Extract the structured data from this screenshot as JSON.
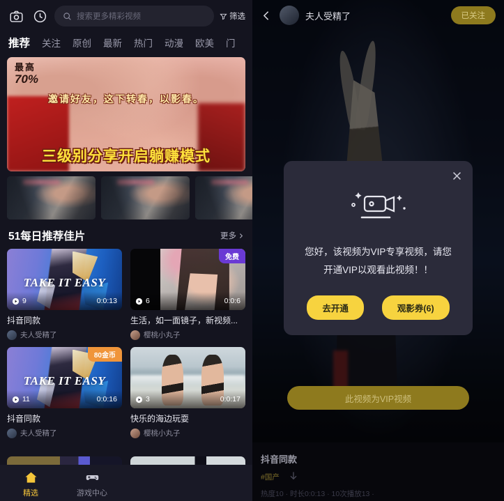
{
  "left": {
    "topbar": {
      "camera_icon": "camera-icon",
      "history_icon": "clock-icon",
      "search_placeholder": "搜索更多精彩视频",
      "search_value": "",
      "filter_label": "筛选",
      "filter_icon": "funnel-icon"
    },
    "tabs": [
      {
        "label": "推荐",
        "active": true
      },
      {
        "label": "关注",
        "active": false
      },
      {
        "label": "原创",
        "active": false
      },
      {
        "label": "最新",
        "active": false
      },
      {
        "label": "热门",
        "active": false
      },
      {
        "label": "动漫",
        "active": false
      },
      {
        "label": "欧美",
        "active": false
      },
      {
        "label": "门",
        "active": false
      }
    ],
    "banner": {
      "top_line1": "最高",
      "top_line2": "70%",
      "mid_text": "邀请好友，这下转春，以影春。",
      "bottom_text": "三级别分享开启躺赚模式"
    },
    "section": {
      "title": "51每日推荐佳片",
      "more_label": "更多",
      "more_icon": "chevron-right-icon"
    },
    "videos": [
      {
        "title": "抖音同款",
        "author": "夫人受精了",
        "plays": "9",
        "duration": "0:0:13",
        "badge": "",
        "badge_type": "none",
        "overlay_text": "TAKE IT EASY"
      },
      {
        "title": "生活，如一面镜子，新视频...",
        "author": "樱桃小丸子",
        "plays": "6",
        "duration": "0:0:6",
        "badge": "免费",
        "badge_type": "free",
        "overlay_text": ""
      },
      {
        "title": "抖音同款",
        "author": "夫人受精了",
        "plays": "11",
        "duration": "0:0:16",
        "badge": "80金币",
        "badge_type": "coin",
        "overlay_text": "TAKE IT EASY"
      },
      {
        "title": "快乐的海边玩耍",
        "author": "樱桃小丸子",
        "plays": "3",
        "duration": "0:0:17",
        "badge": "",
        "badge_type": "none",
        "overlay_text": ""
      }
    ],
    "bottomnav": [
      {
        "label": "精选",
        "icon": "home-icon",
        "active": true
      },
      {
        "label": "游戏中心",
        "icon": "gamepad-icon",
        "active": false
      }
    ]
  },
  "right": {
    "header": {
      "back_icon": "chevron-left-icon",
      "avatar": "user-avatar",
      "username": "夫人受精了",
      "follow_label": "已关注"
    },
    "modal": {
      "close_icon": "close-icon",
      "hero_icon": "video-camera-icon",
      "message_line1": "您好，该视频为VIP专享视频，请您",
      "message_line2": "开通VIP以观看此视频！！",
      "primary_label": "去开通",
      "secondary_label": "观影券(6)"
    },
    "vip_cta_label": "此视频为VIP视频",
    "info": {
      "title": "抖音同款",
      "tag": "#国产",
      "download_icon": "download-icon",
      "stats": "热度10 · 时长0:0:13 · 10次播放13 ·"
    }
  },
  "colors": {
    "accent_yellow": "#f7d33f",
    "dim_yellow": "#8e7a1e",
    "badge_purple": "#6a3ad4",
    "badge_orange": "#f0953a",
    "panel_bg": "#14141f",
    "modal_bg": "#2b2b3a"
  }
}
